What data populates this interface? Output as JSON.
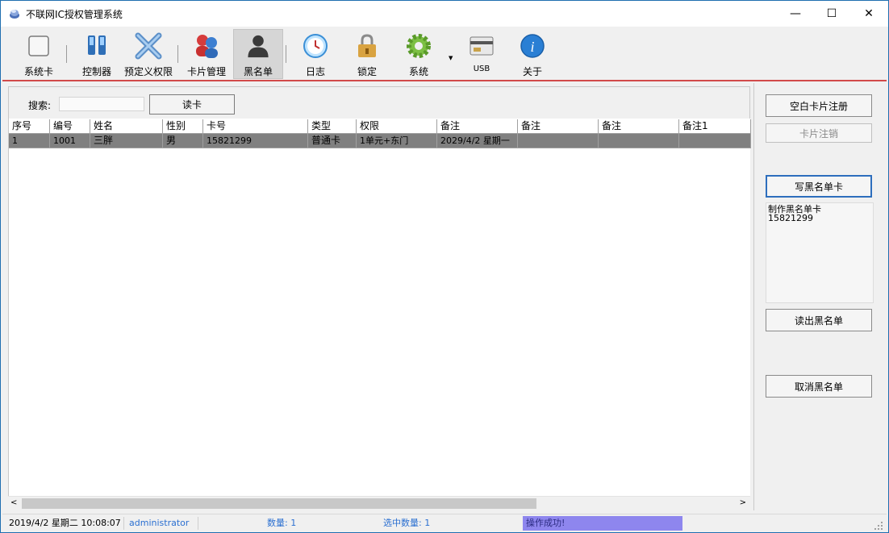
{
  "window": {
    "title": "不联网IC授权管理系统",
    "minimize_glyph": "—",
    "maximize_glyph": "☐",
    "close_glyph": "✕"
  },
  "toolbar": {
    "items": [
      {
        "label": "系统卡",
        "icon": "system-card-icon"
      },
      {
        "label": "控制器",
        "icon": "controller-icon"
      },
      {
        "label": "预定义权限",
        "icon": "permissions-icon"
      },
      {
        "label": "卡片管理",
        "icon": "card-management-icon"
      },
      {
        "label": "黑名单",
        "icon": "blacklist-icon",
        "active": true
      },
      {
        "label": "日志",
        "icon": "log-clock-icon"
      },
      {
        "label": "锁定",
        "icon": "lock-icon"
      },
      {
        "label": "系统",
        "icon": "system-gear-icon"
      },
      {
        "label": "USB",
        "icon": "usb-card-reader-icon"
      },
      {
        "label": "关于",
        "icon": "about-info-icon"
      }
    ],
    "dropdown_glyph": "▼"
  },
  "search": {
    "label": "搜索:",
    "value": "",
    "read_button": "读卡"
  },
  "table": {
    "columns": [
      "序号",
      "编号",
      "姓名",
      "性别",
      "卡号",
      "类型",
      "权限",
      "备注",
      "备注",
      "备注",
      "备注1"
    ],
    "rows": [
      [
        "1",
        "1001",
        "三胖",
        "男",
        "15821299",
        "普通卡",
        "1单元+东门",
        "2029/4/2 星期一",
        "",
        "",
        ""
      ]
    ]
  },
  "scrollbar": {
    "left_glyph": "<",
    "right_glyph": ">"
  },
  "side": {
    "blank_card_register": "空白卡片注册",
    "card_cancel": "卡片注销",
    "write_blacklist_card": "写黑名单卡",
    "memo_line1": "制作黑名单卡",
    "memo_line2": "15821299",
    "read_blacklist": "读出黑名单",
    "cancel_blacklist": "取消黑名单"
  },
  "status": {
    "datetime": "2019/4/2 星期二 10:08:07",
    "user": "administrator",
    "count_label": "数量: 1",
    "selected_label": "选中数量: 1",
    "message": "操作成功!"
  },
  "colors": {
    "accent_line": "#d24a4a",
    "selected_row": "#808080",
    "status_message_bg": "#8e86ee",
    "focus_border": "#2d6ebd"
  }
}
